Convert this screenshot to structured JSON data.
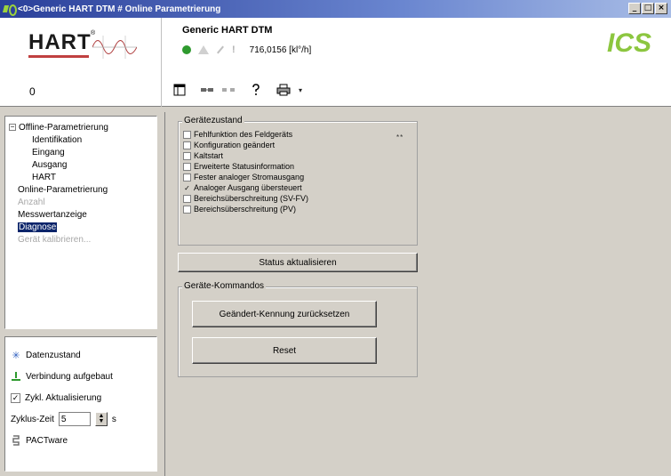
{
  "window": {
    "title": "<0>Generic HART DTM # Online Parametrierung",
    "minimize": "_",
    "restore": "□",
    "close": "×"
  },
  "header": {
    "hart_logo": "HART",
    "device_id": "0",
    "device_name": "Generic HART DTM",
    "pv_value": "716,0156 [kl°/h]",
    "vendor_logo": "ICS"
  },
  "tree": {
    "items": [
      {
        "label": "Offline-Parametrierung",
        "level": 0,
        "expander": "−"
      },
      {
        "label": "Identifikation",
        "level": 1
      },
      {
        "label": "Eingang",
        "level": 1
      },
      {
        "label": "Ausgang",
        "level": 1
      },
      {
        "label": "HART",
        "level": 1
      },
      {
        "label": "Online-Parametrierung",
        "level": 0
      },
      {
        "label": "Anzahl",
        "level": 0,
        "disabled": true
      },
      {
        "label": "Messwertanzeige",
        "level": 0
      },
      {
        "label": "Diagnose",
        "level": 0,
        "selected": true
      },
      {
        "label": "Gerät kalibrieren...",
        "level": 0,
        "disabled": true
      }
    ]
  },
  "status_panel": {
    "data_state": "Datenzustand",
    "connection": "Verbindung aufgebaut",
    "cyclic_update": "Zykl. Aktualisierung",
    "cycle_time_label": "Zyklus-Zeit",
    "cycle_time_value": "5",
    "cycle_time_unit": "s",
    "pactware": "PACTware"
  },
  "device_state": {
    "title": "Gerätezustand",
    "stars": "**",
    "items": [
      {
        "label": "Fehlfunktion des Feldgeräts",
        "checked": false
      },
      {
        "label": "Konfiguration geändert",
        "checked": false
      },
      {
        "label": "Kaltstart",
        "checked": false
      },
      {
        "label": "Erweiterte Statusinformation",
        "checked": false
      },
      {
        "label": "Fester analoger Stromausgang",
        "checked": false
      },
      {
        "label": "Analoger Ausgang übersteuert",
        "checked": true
      },
      {
        "label": "Bereichsüberschreitung (SV-FV)",
        "checked": false
      },
      {
        "label": "Bereichsüberschreitung (PV)",
        "checked": false
      }
    ],
    "refresh_button": "Status aktualisieren"
  },
  "device_commands": {
    "title": "Geräte-Kommandos",
    "reset_changed_button": "Geändert-Kennung zurücksetzen",
    "reset_button": "Reset"
  }
}
